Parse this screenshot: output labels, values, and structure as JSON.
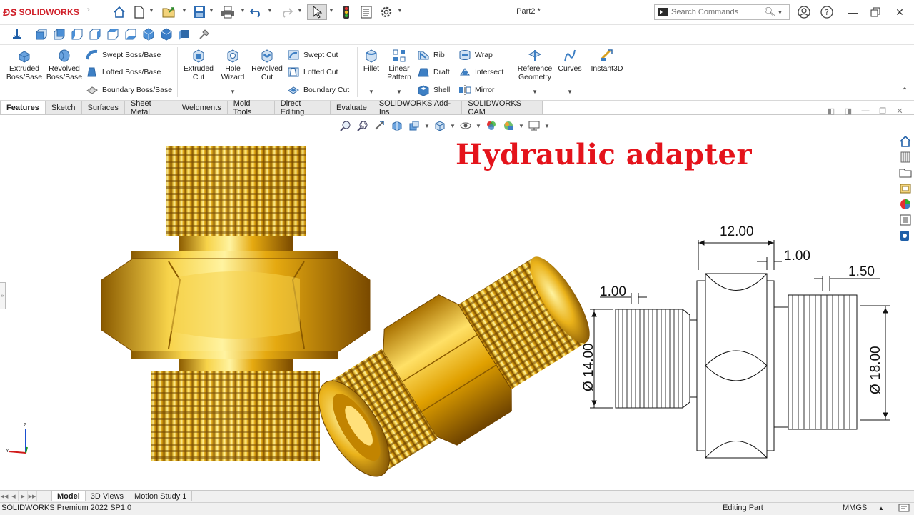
{
  "app": {
    "name": "SOLIDWORKS",
    "document_title": "Part2 *"
  },
  "search": {
    "placeholder": "Search Commands"
  },
  "ribbon": {
    "extruded_boss": "Extruded Boss/Base",
    "revolved_boss": "Revolved Boss/Base",
    "swept_boss": "Swept Boss/Base",
    "lofted_boss": "Lofted Boss/Base",
    "boundary_boss": "Boundary Boss/Base",
    "extruded_cut": "Extruded Cut",
    "hole_wizard": "Hole Wizard",
    "revolved_cut": "Revolved Cut",
    "swept_cut": "Swept Cut",
    "lofted_cut": "Lofted Cut",
    "boundary_cut": "Boundary Cut",
    "fillet": "Fillet",
    "linear_pattern": "Linear Pattern",
    "rib": "Rib",
    "draft": "Draft",
    "shell": "Shell",
    "wrap": "Wrap",
    "intersect": "Intersect",
    "mirror": "Mirror",
    "reference_geometry": "Reference Geometry",
    "curves": "Curves",
    "instant3d": "Instant3D"
  },
  "tabs": [
    "Features",
    "Sketch",
    "Surfaces",
    "Sheet Metal",
    "Weldments",
    "Mold Tools",
    "Direct Editing",
    "Evaluate",
    "SOLIDWORKS Add-Ins",
    "SOLIDWORKS CAM"
  ],
  "graphics": {
    "title": "Hydraulic adapter",
    "dims": {
      "length": "12.00",
      "gap": "1.00",
      "pitch_left": "1.00",
      "pitch_right": "1.50",
      "dia_left": "Ø 14.00",
      "dia_right": "Ø 18.00"
    },
    "triad": {
      "z": "Z",
      "y": "Y"
    }
  },
  "bottom_tabs": [
    "Model",
    "3D Views",
    "Motion Study 1"
  ],
  "status": {
    "version": "SOLIDWORKS Premium 2022 SP1.0",
    "mode": "Editing Part",
    "units": "MMGS"
  },
  "colors": {
    "brand": "#d0202a",
    "title": "#e4131b",
    "gold": "#d4a017",
    "icon_blue": "#3d7fc4"
  }
}
